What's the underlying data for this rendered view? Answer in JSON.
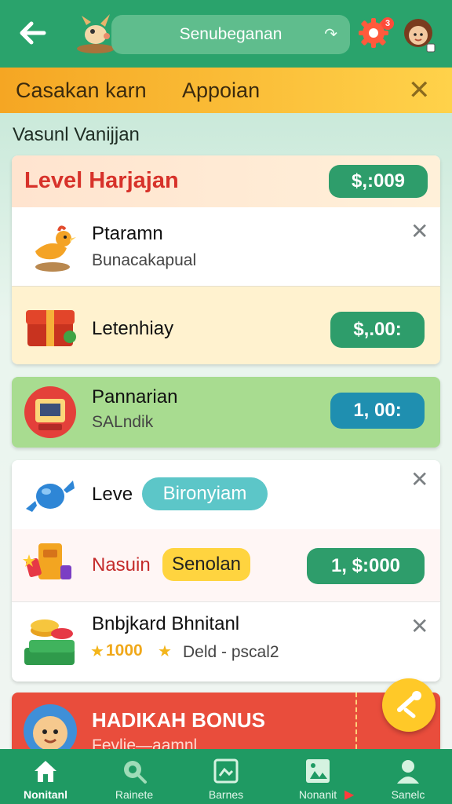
{
  "header": {
    "search_text": "Senubeganan",
    "notification_count": "3"
  },
  "banner": {
    "text_left": "Casakan karn",
    "text_right": "Appoian"
  },
  "section_title": "Vasunl Vanijjan",
  "card1": {
    "header_title": "Level Harjajan",
    "header_amount": "$,:009",
    "item1": {
      "title": "Ptaramn",
      "subtitle": "Bunacakapual"
    },
    "item2": {
      "title": "Letenhiay",
      "amount": "$,.00:"
    }
  },
  "card2": {
    "title": "Pannarian",
    "subtitle": "SALndik",
    "amount": "1, 00:"
  },
  "card3": {
    "item1": {
      "title": "Leve",
      "tag": "Bironyiam"
    },
    "item2": {
      "title": "Nasuin",
      "tag": "Senolan",
      "amount": "1, $:000"
    },
    "item3": {
      "title": "Bnbjkard Bhnitanl",
      "stars": "1000",
      "subtitle": "Deld - pscal2"
    }
  },
  "promo": {
    "title": "HADIKAH BONUS",
    "subtitle": "Fevlie—aamnl"
  },
  "nav": [
    {
      "label": "Nonitanl",
      "icon": "home-icon"
    },
    {
      "label": "Rainete",
      "icon": "search-icon"
    },
    {
      "label": "Barnes",
      "icon": "image-icon"
    },
    {
      "label": "Nonanit",
      "icon": "gallery-icon"
    },
    {
      "label": "Sanelc",
      "icon": "profile-icon"
    }
  ],
  "colors": {
    "primary_green": "#2aa36c",
    "banner_orange": "#f5a623",
    "pill_green": "#2e9d6b",
    "pill_blue": "#1f8fb0",
    "promo_red": "#e94d3c",
    "fab_yellow": "#ffc928"
  }
}
